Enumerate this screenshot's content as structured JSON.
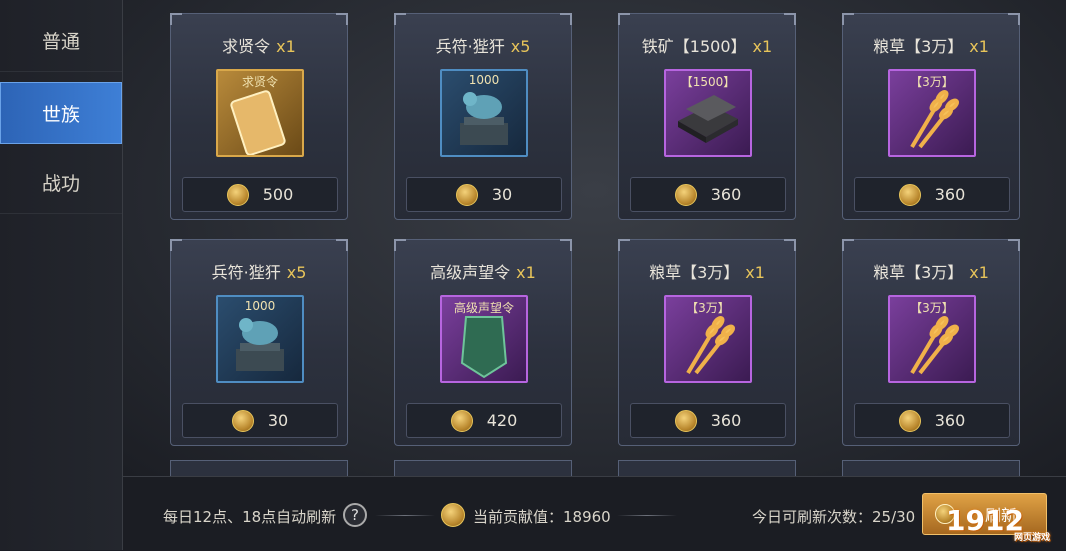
{
  "sidebar": {
    "tabs": [
      {
        "label": "普通"
      },
      {
        "label": "世族",
        "active": true
      },
      {
        "label": "战功"
      }
    ]
  },
  "shop": {
    "items": [
      {
        "name": "求贤令",
        "qty": "x1",
        "icon_label": "求贤令",
        "icon": "recruit-token-icon",
        "frame": "gold",
        "price": "500"
      },
      {
        "name": "兵符·狴犴",
        "qty": "x5",
        "icon_label": "1000",
        "icon": "beast-statue-icon",
        "frame": "blue",
        "price": "30"
      },
      {
        "name": "铁矿【1500】",
        "qty": "x1",
        "icon_label": "【1500】",
        "icon": "iron-ingot-icon",
        "frame": "purple",
        "price": "360"
      },
      {
        "name": "粮草【3万】",
        "qty": "x1",
        "icon_label": "【3万】",
        "icon": "wheat-icon",
        "frame": "purple",
        "price": "360"
      },
      {
        "name": "兵符·狴犴",
        "qty": "x5",
        "icon_label": "1000",
        "icon": "beast-statue-icon",
        "frame": "blue",
        "price": "30"
      },
      {
        "name": "高级声望令",
        "qty": "x1",
        "icon_label": "高级声望令",
        "icon": "prestige-token-icon",
        "frame": "purple",
        "price": "420"
      },
      {
        "name": "粮草【3万】",
        "qty": "x1",
        "icon_label": "【3万】",
        "icon": "wheat-icon",
        "frame": "purple",
        "price": "360"
      },
      {
        "name": "粮草【3万】",
        "qty": "x1",
        "icon_label": "【3万】",
        "icon": "wheat-icon",
        "frame": "purple",
        "price": "360"
      }
    ]
  },
  "footer": {
    "auto_refresh": "每日12点、18点自动刷新",
    "help": "?",
    "contribution": "当前贡献值：18960",
    "refresh_count": "今日可刷新次数：25/30",
    "refresh_button": "刷新"
  },
  "watermark": {
    "main": "1912",
    "sub": "网页游戏"
  },
  "colors": {
    "accent_blue": "#3e7fd6",
    "gold": "#e7c45a",
    "panel": "#2c313e"
  }
}
